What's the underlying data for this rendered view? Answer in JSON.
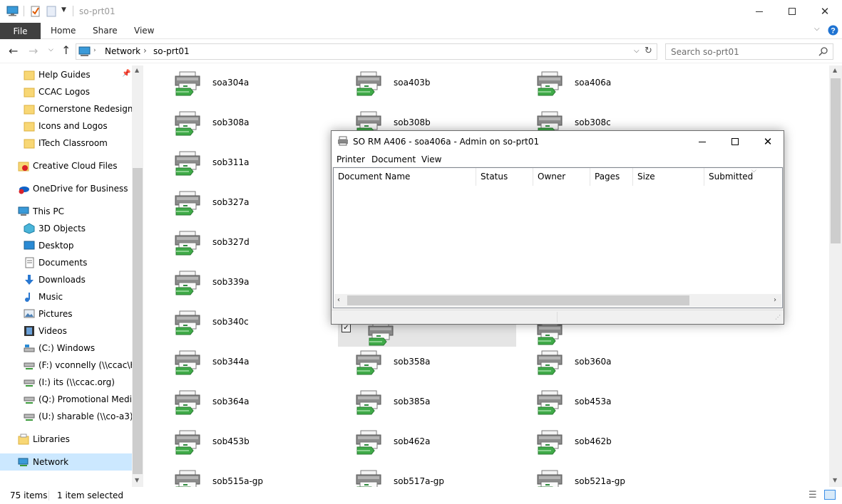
{
  "window": {
    "title": "so-prt01",
    "minimize_glyph": "—",
    "maximize_glyph": "☐",
    "close_glyph": "✕"
  },
  "ribbon": {
    "file": "File",
    "tabs": [
      "Home",
      "Share",
      "View"
    ]
  },
  "address": {
    "path": [
      "Network",
      "so-prt01"
    ],
    "search_placeholder": "Search so-prt01"
  },
  "nav": {
    "items": [
      {
        "label": "Help Guides",
        "icon": "folder-icon"
      },
      {
        "label": "CCAC Logos",
        "icon": "folder-icon"
      },
      {
        "label": "Cornerstone Redesign",
        "icon": "folder-icon"
      },
      {
        "label": "Icons and Logos",
        "icon": "folder-icon"
      },
      {
        "label": "ITech Classroom",
        "icon": "folder-icon"
      },
      {
        "label": "Creative Cloud Files",
        "icon": "creative-cloud-icon"
      },
      {
        "label": "OneDrive for Business",
        "icon": "onedrive-icon"
      },
      {
        "label": "This PC",
        "icon": "computer-icon"
      },
      {
        "label": "3D Objects",
        "icon": "3d-objects-icon"
      },
      {
        "label": "Desktop",
        "icon": "desktop-icon"
      },
      {
        "label": "Documents",
        "icon": "documents-icon"
      },
      {
        "label": "Downloads",
        "icon": "downloads-icon"
      },
      {
        "label": "Music",
        "icon": "music-icon"
      },
      {
        "label": "Pictures",
        "icon": "pictures-icon"
      },
      {
        "label": "Videos",
        "icon": "videos-icon"
      },
      {
        "label": "(C:) Windows",
        "icon": "drive-icon"
      },
      {
        "label": "(F:) vconnelly (\\\\ccac\\Ho",
        "icon": "network-drive-icon"
      },
      {
        "label": "(I:) its (\\\\ccac.org)",
        "icon": "network-drive-icon"
      },
      {
        "label": "(Q:) Promotional Media",
        "icon": "network-drive-icon"
      },
      {
        "label": "(U:) sharable (\\\\co-a3)",
        "icon": "network-drive-icon"
      },
      {
        "label": "Libraries",
        "icon": "libraries-icon"
      },
      {
        "label": "Network",
        "icon": "network-icon"
      }
    ]
  },
  "printers": [
    [
      "soa304a",
      "soa403b",
      "soa406a"
    ],
    [
      "sob308a",
      "sob308b",
      "sob308c"
    ],
    [
      "sob311a",
      "",
      ""
    ],
    [
      "sob327a",
      "",
      ""
    ],
    [
      "sob327d",
      "",
      ""
    ],
    [
      "sob339a",
      "",
      ""
    ],
    [
      "sob340c",
      "",
      ""
    ],
    [
      "sob344a",
      "sob358a",
      "sob360a"
    ],
    [
      "sob364a",
      "sob385a",
      "sob453a"
    ],
    [
      "sob453b",
      "sob462a",
      "sob462b"
    ],
    [
      "sob515a-gp",
      "sob517a-gp",
      "sob521a-gp"
    ]
  ],
  "status": {
    "count": "75 items",
    "selected": "1 item selected"
  },
  "dialog": {
    "title": "SO RM A406 - soa406a - Admin on so-prt01",
    "menu": [
      "Printer",
      "Document",
      "View"
    ],
    "columns": [
      "Document Name",
      "Status",
      "Owner",
      "Pages",
      "Size",
      "Submitted"
    ]
  }
}
